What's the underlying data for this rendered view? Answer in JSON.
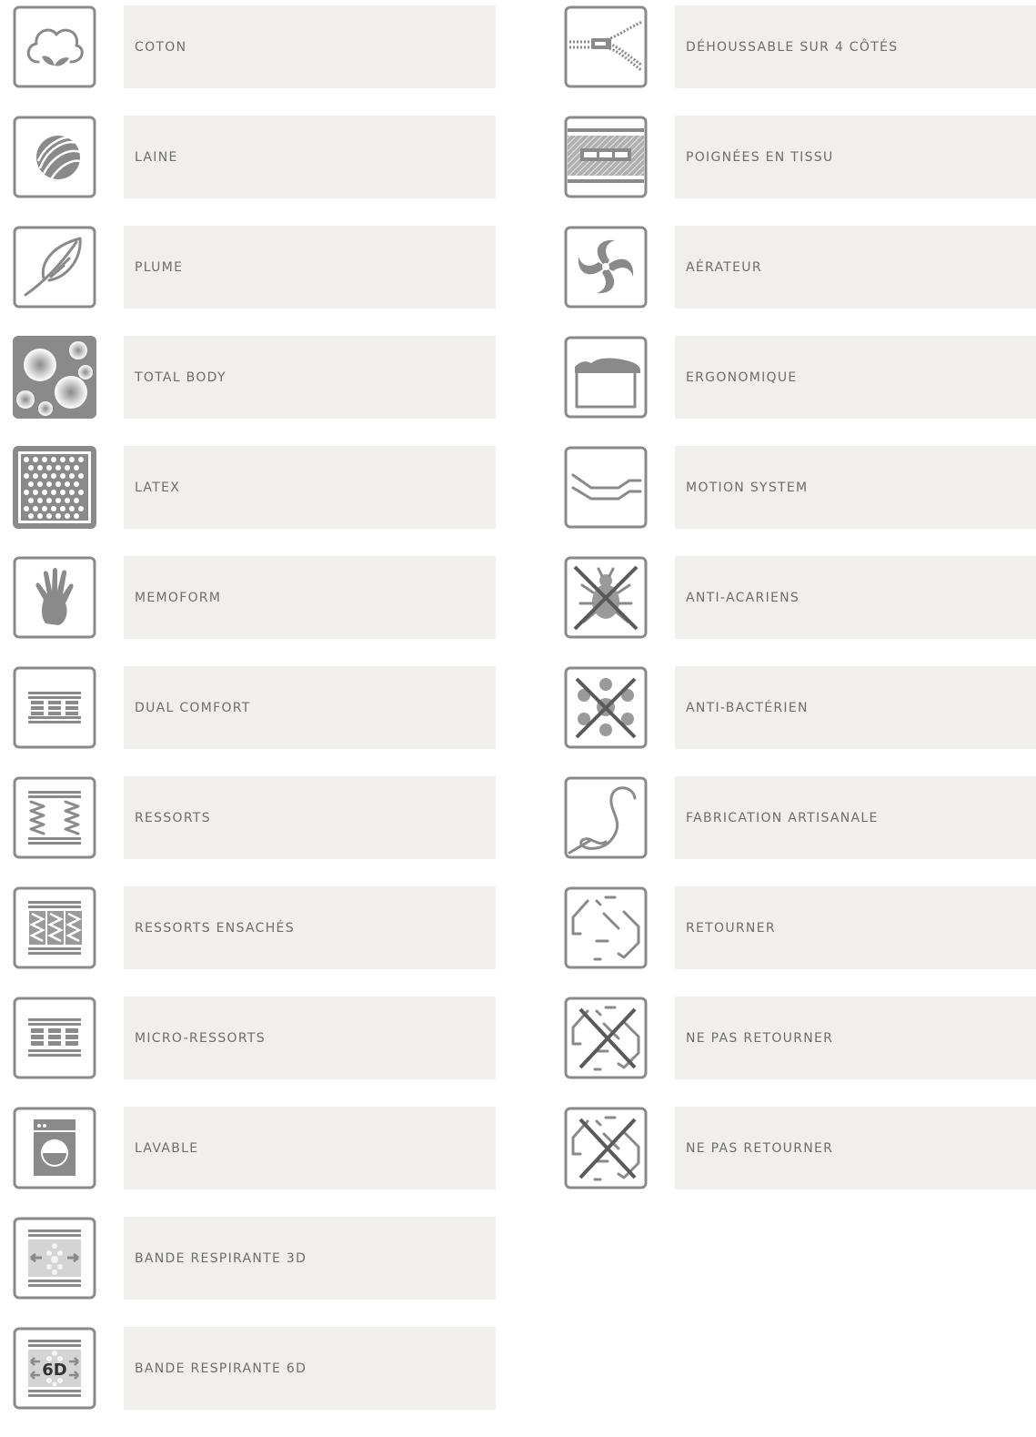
{
  "left_column": [
    {
      "icon": "cotton-icon",
      "label": "COTON"
    },
    {
      "icon": "wool-icon",
      "label": "LAINE"
    },
    {
      "icon": "feather-icon",
      "label": "PLUME"
    },
    {
      "icon": "total-body-icon",
      "label": "TOTAL BODY"
    },
    {
      "icon": "latex-icon",
      "label": "LATEX"
    },
    {
      "icon": "memoform-hand-icon",
      "label": "MEMOFORM"
    },
    {
      "icon": "dual-comfort-icon",
      "label": "DUAL COMFORT"
    },
    {
      "icon": "springs-icon",
      "label": "RESSORTS"
    },
    {
      "icon": "pocket-springs-icon",
      "label": "RESSORTS ENSACHÉS"
    },
    {
      "icon": "micro-springs-icon",
      "label": "MICRO-RESSORTS"
    },
    {
      "icon": "washing-machine-icon",
      "label": "LAVABLE"
    },
    {
      "icon": "breathable-band-3d-icon",
      "label": "BANDE RESPIRANTE 3D"
    },
    {
      "icon": "breathable-band-6d-icon",
      "label": "BANDE RESPIRANTE 6D",
      "badge": "6D"
    }
  ],
  "right_column": [
    {
      "icon": "zipper-icon",
      "label": "DÉHOUSSABLE SUR 4 CÔTÉS"
    },
    {
      "icon": "fabric-handles-icon",
      "label": "POIGNÉES EN TISSU"
    },
    {
      "icon": "aerator-icon",
      "label": "AÉRATEUR"
    },
    {
      "icon": "ergonomic-icon",
      "label": "ERGONOMIQUE"
    },
    {
      "icon": "motion-system-icon",
      "label": "MOTION SYSTEM"
    },
    {
      "icon": "anti-mite-icon",
      "label": "ANTI-ACARIENS"
    },
    {
      "icon": "anti-bacterial-icon",
      "label": "ANTI-BACTÉRIEN"
    },
    {
      "icon": "handmade-icon",
      "label": "FABRICATION ARTISANALE"
    },
    {
      "icon": "flip-icon",
      "label": "RETOURNER"
    },
    {
      "icon": "no-flip-icon",
      "label": "NE PAS RETOURNER"
    },
    {
      "icon": "no-flip-icon",
      "label": "NE PAS RETOURNER"
    }
  ],
  "colors": {
    "icon_gray": "#8a8a8a",
    "label_bg": "#f0efee",
    "label_text": "#6e6e6e"
  }
}
